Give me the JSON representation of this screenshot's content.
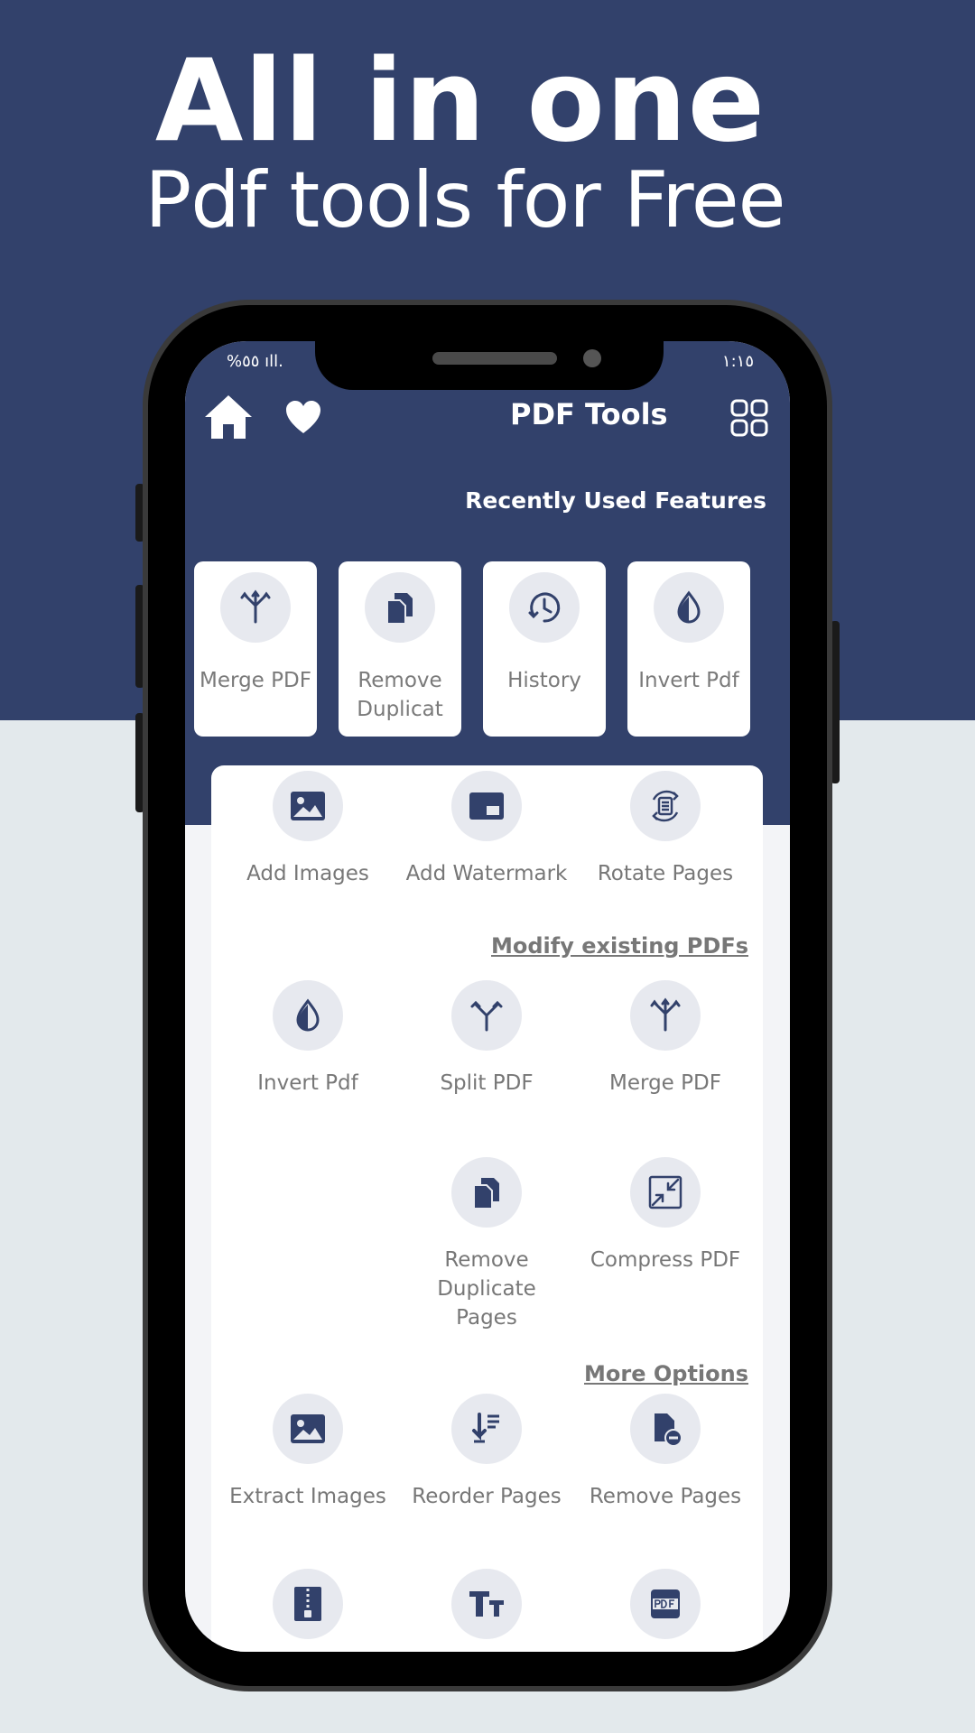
{
  "hero": {
    "title": "All in one",
    "subtitle": "Pdf tools for Free"
  },
  "status_bar": {
    "left": "%٥٥ ıll.",
    "right": "١:١٥"
  },
  "app_bar": {
    "title": "PDF Tools",
    "icons": [
      "home-icon",
      "heart-icon",
      "grid-icon"
    ]
  },
  "recent": {
    "heading": "Recently Used Features",
    "items": [
      {
        "label": "Merge PDF",
        "icon": "merge-icon"
      },
      {
        "label": "Remove Duplicat",
        "icon": "duplicate-icon"
      },
      {
        "label": "History",
        "icon": "history-icon"
      },
      {
        "label": "Invert Pdf",
        "icon": "invert-icon"
      }
    ]
  },
  "top_tools": [
    {
      "label": "Add Images",
      "icon": "image-icon"
    },
    {
      "label": "Add Watermark",
      "icon": "watermark-icon"
    },
    {
      "label": "Rotate Pages",
      "icon": "rotate-icon"
    }
  ],
  "modify": {
    "heading": "Modify existing PDFs",
    "items": [
      {
        "label": "Invert Pdf",
        "icon": "invert-icon"
      },
      {
        "label": "Split PDF",
        "icon": "split-icon"
      },
      {
        "label": "Merge PDF",
        "icon": "merge-icon"
      },
      {
        "label": "Remove Duplicate Pages",
        "icon": "duplicate-icon"
      },
      {
        "label": "Compress PDF",
        "icon": "compress-icon"
      }
    ]
  },
  "more": {
    "heading": "More Options",
    "items": [
      {
        "label": "Extract Images",
        "icon": "image-icon"
      },
      {
        "label": "Reorder Pages",
        "icon": "reorder-icon"
      },
      {
        "label": "Remove Pages",
        "icon": "remove-page-icon"
      }
    ],
    "partial_icons": [
      "zip-icon",
      "text-icon",
      "pdf-icon"
    ]
  },
  "colors": {
    "primary": "#32416b",
    "background": "#e3e9ec",
    "icon_bg": "#e7e9ef",
    "label": "#777777"
  }
}
